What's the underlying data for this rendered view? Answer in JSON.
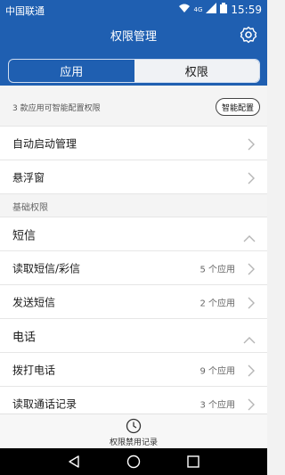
{
  "status_bar": {
    "carrier": "中国联通",
    "network": "4G",
    "time": "15:59"
  },
  "header": {
    "title": "权限管理",
    "settings_icon": "gear-icon"
  },
  "tabs": [
    {
      "label": "应用",
      "active": false
    },
    {
      "label": "权限",
      "active": true
    }
  ],
  "info": {
    "text": "3 款应用可智能配置权限",
    "button_label": "智能配置"
  },
  "top_items": [
    {
      "label": "自动启动管理"
    },
    {
      "label": "悬浮窗"
    }
  ],
  "section_label": "基础权限",
  "groups": [
    {
      "label": "短信",
      "expanded": true,
      "items": [
        {
          "label": "读取短信/彩信",
          "count": "5 个应用"
        },
        {
          "label": "发送短信",
          "count": "2 个应用"
        }
      ]
    },
    {
      "label": "电话",
      "expanded": true,
      "items": [
        {
          "label": "拨打电话",
          "count": "9 个应用"
        },
        {
          "label": "读取通话记录",
          "count": "3 个应用"
        }
      ]
    }
  ],
  "bottom_bar": {
    "label": "权限禁用记录",
    "icon": "clock-icon"
  },
  "nav": {
    "back": "back-icon",
    "home": "home-icon",
    "recents": "recents-icon"
  },
  "colors": {
    "header": "#1f5fb1",
    "background": "#f2f2f2"
  }
}
